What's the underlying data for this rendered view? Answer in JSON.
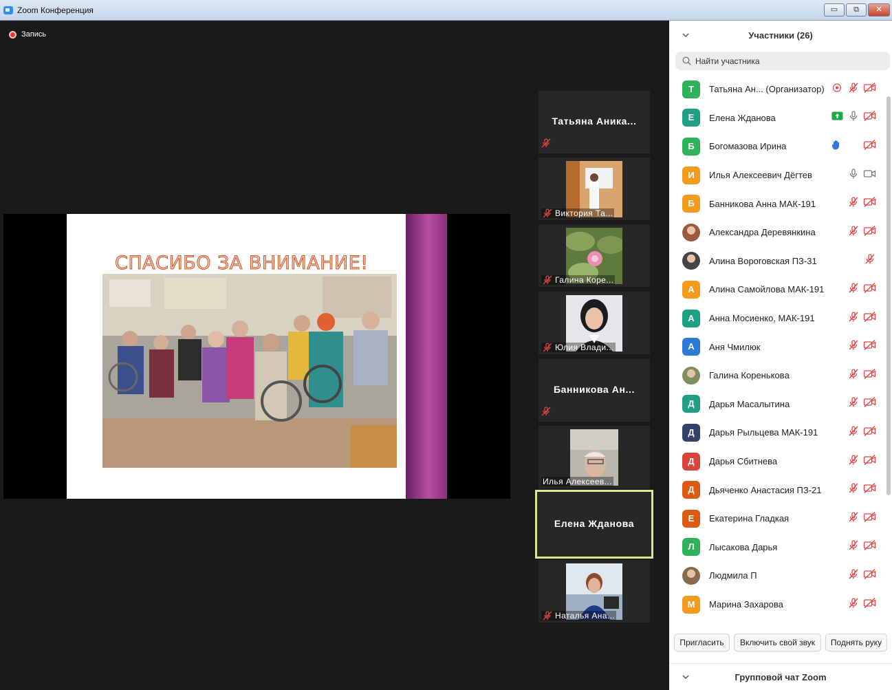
{
  "window": {
    "title": "Zoom Конференция",
    "minimize": "▭",
    "restore": "⧉",
    "close": "✕"
  },
  "recording": {
    "label": "Запись"
  },
  "slide": {
    "title": "СПАСИБО ЗА ВНИМАНИЕ!"
  },
  "tiles": [
    {
      "label": "Татьяна  Аника...",
      "kind": "name",
      "muted": true
    },
    {
      "label": "Виктория Та...",
      "kind": "video",
      "muted": true
    },
    {
      "label": "Галина Коре...",
      "kind": "video",
      "muted": true
    },
    {
      "label": "Юлия Влади...",
      "kind": "video",
      "muted": true
    },
    {
      "label": "Банникова  Ан...",
      "kind": "name",
      "muted": true
    },
    {
      "label": "Илья Алексеев...",
      "kind": "video",
      "muted": false
    },
    {
      "label": "Елена Жданова",
      "kind": "name",
      "active": true
    },
    {
      "label": "Наталья Ана...",
      "kind": "video",
      "muted": true
    }
  ],
  "participants_panel": {
    "title": "Участники (26)",
    "search_placeholder": "Найти участника",
    "participants": [
      {
        "initial": "Т",
        "color": "#2eb35a",
        "name": "Татьяна Ан...  (Организатор)",
        "mic": "muted",
        "cam": "off",
        "extra": "record-icon"
      },
      {
        "initial": "Е",
        "color": "#20a083",
        "name": "Елена Жданова",
        "mic": "on",
        "cam": "off",
        "extra": "share-icon"
      },
      {
        "initial": "Б",
        "color": "#2eb35a",
        "name": "Богомазова Ирина",
        "mic": "none",
        "cam": "off",
        "extra": "raised-hand-icon"
      },
      {
        "initial": "И",
        "color": "#f29b1d",
        "name": "Илья Алексеевич Дёгтев",
        "mic": "on",
        "cam": "on",
        "extra": ""
      },
      {
        "initial": "Б",
        "color": "#f29b1d",
        "name": " Банникова Анна МАК-191",
        "mic": "muted",
        "cam": "off",
        "extra": ""
      },
      {
        "initial": "",
        "color": "#9a5a3c",
        "name": "Александра Деревянкина",
        "mic": "muted",
        "cam": "off",
        "extra": "",
        "photo": true
      },
      {
        "initial": "",
        "color": "#444444",
        "name": "Алина Вороговская ПЗ-31",
        "mic": "none",
        "cam": "muted-only",
        "extra": "",
        "photo": true
      },
      {
        "initial": "А",
        "color": "#f29b1d",
        "name": "Алина Самойлова МАК-191",
        "mic": "muted",
        "cam": "off",
        "extra": ""
      },
      {
        "initial": "А",
        "color": "#20a083",
        "name": "Анна Мосиенко, МАК-191",
        "mic": "muted",
        "cam": "off",
        "extra": ""
      },
      {
        "initial": "А",
        "color": "#2d7bd6",
        "name": "Аня Чмилюк",
        "mic": "muted",
        "cam": "off",
        "extra": ""
      },
      {
        "initial": "",
        "color": "#7c8f5c",
        "name": "Галина Кореньковa",
        "mic": "muted",
        "cam": "off",
        "extra": "",
        "photo": true
      },
      {
        "initial": "Д",
        "color": "#20a083",
        "name": "Дарья Масалытина",
        "mic": "muted",
        "cam": "off",
        "extra": ""
      },
      {
        "initial": "Д",
        "color": "#33416b",
        "name": "Дарья Рыльцева МАК-191",
        "mic": "muted",
        "cam": "off",
        "extra": ""
      },
      {
        "initial": "Д",
        "color": "#d9453a",
        "name": "Дарья Сбитнева",
        "mic": "muted",
        "cam": "off",
        "extra": ""
      },
      {
        "initial": "Д",
        "color": "#dc5a12",
        "name": "Дьяченко Анастасия ПЗ-21",
        "mic": "muted",
        "cam": "off",
        "extra": ""
      },
      {
        "initial": "Е",
        "color": "#dc5a12",
        "name": "Екатерина Гладкая",
        "mic": "muted",
        "cam": "off",
        "extra": ""
      },
      {
        "initial": "Л",
        "color": "#2eb35a",
        "name": "Лысакова Дарья",
        "mic": "muted",
        "cam": "off",
        "extra": ""
      },
      {
        "initial": "",
        "color": "#8a6a4a",
        "name": "Людмила П",
        "mic": "muted",
        "cam": "off",
        "extra": "",
        "photo": true
      },
      {
        "initial": "М",
        "color": "#f29b1d",
        "name": "Марина Захарова",
        "mic": "muted",
        "cam": "off",
        "extra": ""
      }
    ],
    "buttons": {
      "invite": "Пригласить",
      "unmute": "Включить свой звук",
      "raise_hand": "Поднять руку"
    }
  },
  "chat": {
    "title": "Групповой чат Zoom"
  }
}
